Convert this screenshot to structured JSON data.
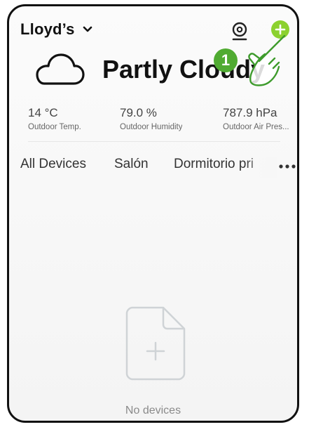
{
  "header": {
    "home_name": "Lloyd’s",
    "accent_color": "#8cd12f"
  },
  "weather": {
    "condition": "Partly Cloudy",
    "icon": "cloud-icon"
  },
  "stats": [
    {
      "value": "14 °C",
      "label": "Outdoor Temp."
    },
    {
      "value": "79.0 %",
      "label": "Outdoor Humidity"
    },
    {
      "value": "787.9 hPa",
      "label": "Outdoor Air Pres..."
    }
  ],
  "tabs": [
    {
      "label": "All Devices"
    },
    {
      "label": "Salón"
    },
    {
      "label": "Dormitorio pri"
    }
  ],
  "empty_state": {
    "label": "No devices",
    "icon": "add-file-icon"
  },
  "annotation": {
    "step": "1",
    "color": "#50ab32"
  }
}
